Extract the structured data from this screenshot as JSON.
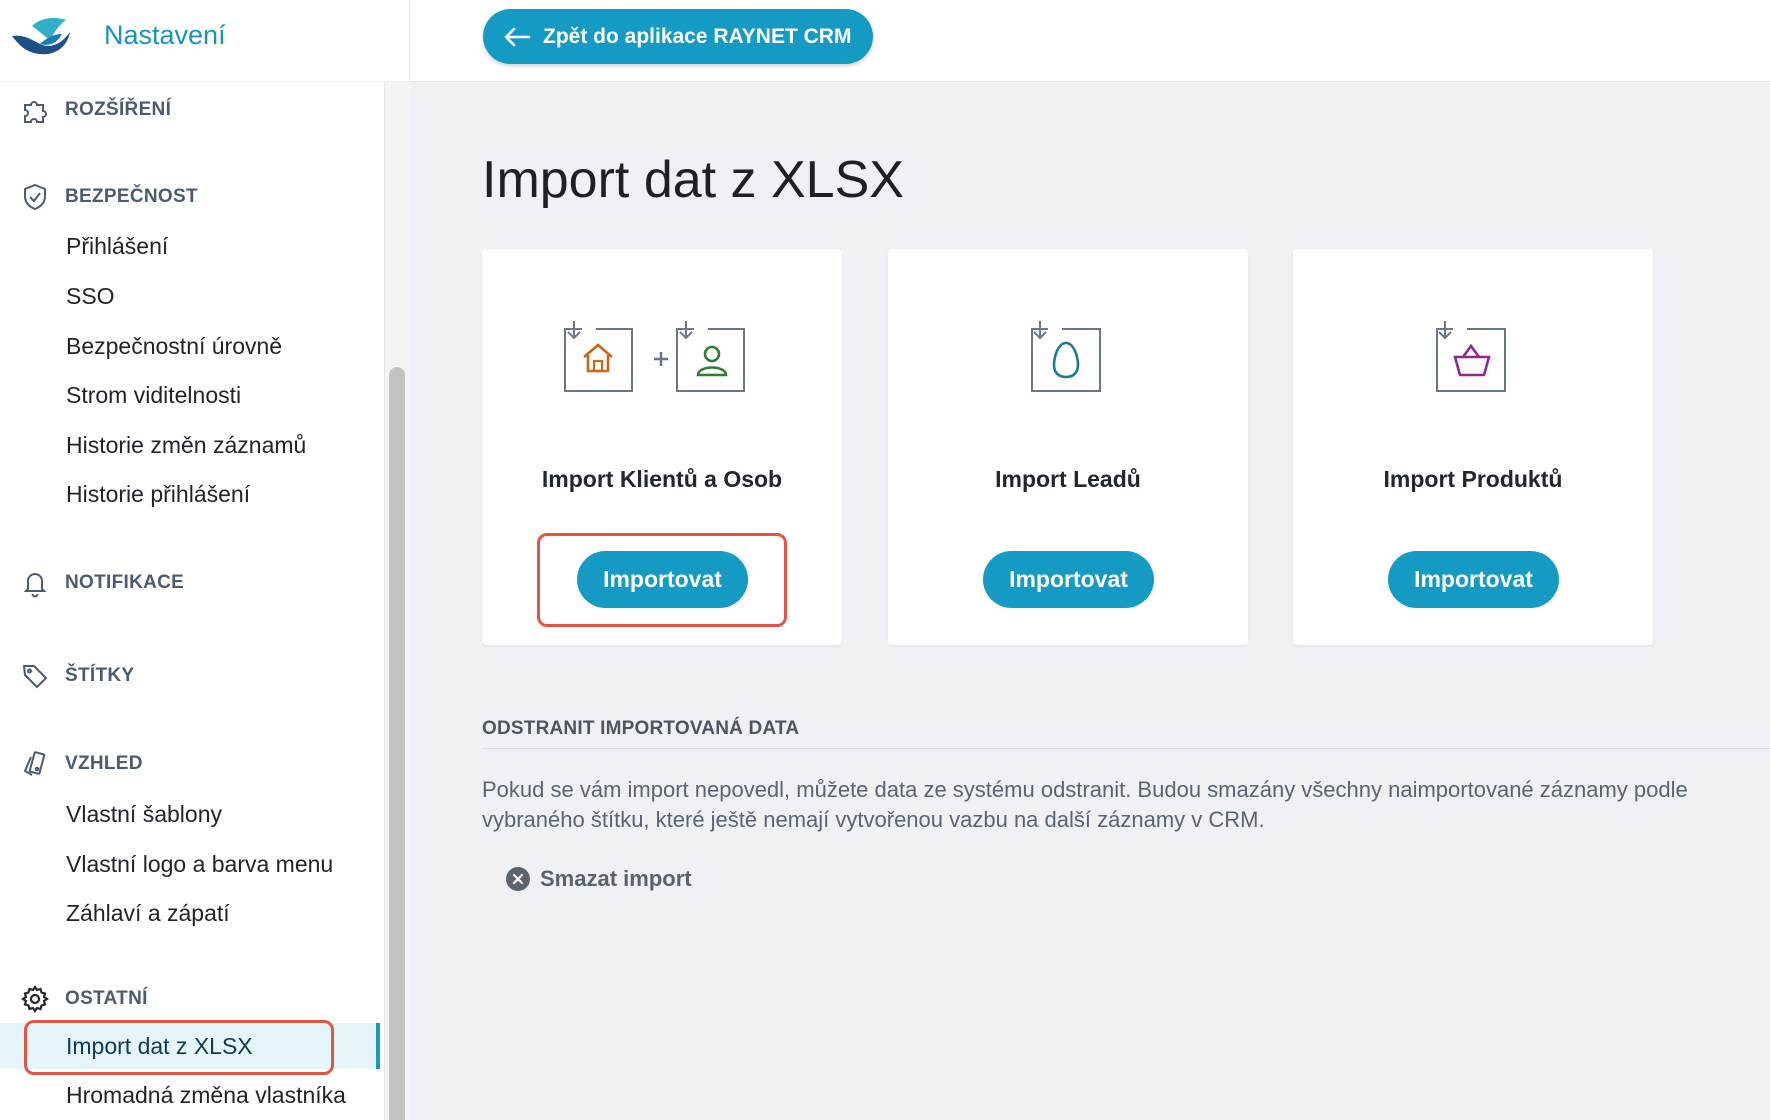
{
  "app": {
    "title": "Nastavení"
  },
  "topbar": {
    "back_label": "Zpět do aplikace RAYNET CRM"
  },
  "sidebar": {
    "sections": [
      {
        "label": "ROZŠÍŘENÍ",
        "icon": "puzzle-icon",
        "items": []
      },
      {
        "label": "BEZPEČNOST",
        "icon": "shield-check-icon",
        "items": [
          "Přihlášení",
          "SSO",
          "Bezpečnostní úrovně",
          "Strom viditelnosti",
          "Historie změn záznamů",
          "Historie přihlášení"
        ]
      },
      {
        "label": "NOTIFIKACE",
        "icon": "bell-icon",
        "items": []
      },
      {
        "label": "ŠTÍTKY",
        "icon": "tag-icon",
        "items": []
      },
      {
        "label": "VZHLED",
        "icon": "palette-icon",
        "items": [
          "Vlastní šablony",
          "Vlastní logo a barva menu",
          "Záhlaví a zápatí"
        ]
      },
      {
        "label": "OSTATNÍ",
        "icon": "gear-icon",
        "items": [
          "Import dat z XLSX",
          "Hromadná změna vlastníka"
        ]
      }
    ],
    "active_item": "Import dat z XLSX"
  },
  "main": {
    "title": "Import dat z XLSX",
    "cards": [
      {
        "title": "Import Klientů a Osob",
        "icon": "import-clients-persons-icon",
        "button": "Importovat"
      },
      {
        "title": "Import Leadů",
        "icon": "import-leads-icon",
        "button": "Importovat"
      },
      {
        "title": "Import Produktů",
        "icon": "import-products-icon",
        "button": "Importovat"
      }
    ],
    "delete_section": {
      "heading": "ODSTRANIT IMPORTOVANÁ DATA",
      "text": "Pokud se vám import nepovedl, můžete data ze systému odstranit. Budou smazány všechny naimportované záznamy podle vybraného štítku, které ještě nemají vytvořenou vazbu na další záznamy v CRM.",
      "action": "Smazat import"
    }
  },
  "colors": {
    "accent": "#159ac4",
    "highlight": "#e05545",
    "active_bg": "#e6f5fa"
  }
}
